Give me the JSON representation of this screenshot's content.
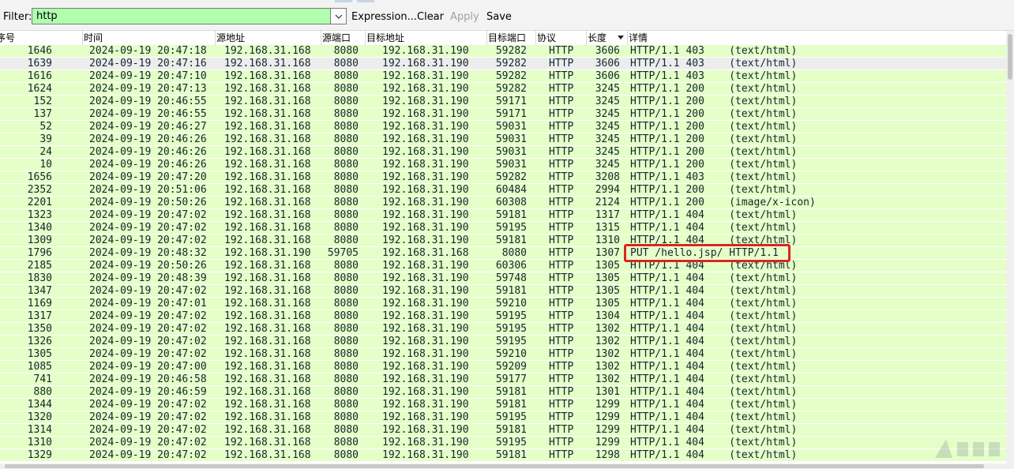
{
  "filter": {
    "label": "Filter:",
    "value": "http",
    "expression_label": "Expression...",
    "clear_label": "Clear",
    "apply_label": "Apply",
    "save_label": "Save"
  },
  "columns": [
    "序号",
    "时间",
    "源地址",
    "源端口",
    "目标地址",
    "目标端口",
    "协议",
    "长度",
    "详情"
  ],
  "selected_row_index": 1,
  "highlighted_row_index": 16,
  "colors": {
    "http_row": "#e4ffc7",
    "selected_row": "#ededed",
    "filter_ok": "#afffaf",
    "highlight_box": "#d9261c"
  },
  "rows": [
    {
      "no": "1646",
      "time": "2024-09-19 20:47:18",
      "src": "192.168.31.168",
      "sport": "8080",
      "dst": "192.168.31.190",
      "dport": "59282",
      "proto": "HTTP",
      "len": "3606",
      "info": "HTTP/1.1 403    (text/html)"
    },
    {
      "no": "1639",
      "time": "2024-09-19 20:47:16",
      "src": "192.168.31.168",
      "sport": "8080",
      "dst": "192.168.31.190",
      "dport": "59282",
      "proto": "HTTP",
      "len": "3606",
      "info": "HTTP/1.1 403    (text/html)"
    },
    {
      "no": "1616",
      "time": "2024-09-19 20:47:10",
      "src": "192.168.31.168",
      "sport": "8080",
      "dst": "192.168.31.190",
      "dport": "59282",
      "proto": "HTTP",
      "len": "3606",
      "info": "HTTP/1.1 403    (text/html)"
    },
    {
      "no": "1624",
      "time": "2024-09-19 20:47:13",
      "src": "192.168.31.168",
      "sport": "8080",
      "dst": "192.168.31.190",
      "dport": "59282",
      "proto": "HTTP",
      "len": "3245",
      "info": "HTTP/1.1 200    (text/html)"
    },
    {
      "no": "152",
      "time": "2024-09-19 20:46:55",
      "src": "192.168.31.168",
      "sport": "8080",
      "dst": "192.168.31.190",
      "dport": "59171",
      "proto": "HTTP",
      "len": "3245",
      "info": "HTTP/1.1 200    (text/html)"
    },
    {
      "no": "137",
      "time": "2024-09-19 20:46:55",
      "src": "192.168.31.168",
      "sport": "8080",
      "dst": "192.168.31.190",
      "dport": "59171",
      "proto": "HTTP",
      "len": "3245",
      "info": "HTTP/1.1 200    (text/html)"
    },
    {
      "no": "52",
      "time": "2024-09-19 20:46:27",
      "src": "192.168.31.168",
      "sport": "8080",
      "dst": "192.168.31.190",
      "dport": "59031",
      "proto": "HTTP",
      "len": "3245",
      "info": "HTTP/1.1 200    (text/html)"
    },
    {
      "no": "39",
      "time": "2024-09-19 20:46:26",
      "src": "192.168.31.168",
      "sport": "8080",
      "dst": "192.168.31.190",
      "dport": "59031",
      "proto": "HTTP",
      "len": "3245",
      "info": "HTTP/1.1 200    (text/html)"
    },
    {
      "no": "24",
      "time": "2024-09-19 20:46:26",
      "src": "192.168.31.168",
      "sport": "8080",
      "dst": "192.168.31.190",
      "dport": "59031",
      "proto": "HTTP",
      "len": "3245",
      "info": "HTTP/1.1 200    (text/html)"
    },
    {
      "no": "10",
      "time": "2024-09-19 20:46:26",
      "src": "192.168.31.168",
      "sport": "8080",
      "dst": "192.168.31.190",
      "dport": "59031",
      "proto": "HTTP",
      "len": "3245",
      "info": "HTTP/1.1 200    (text/html)"
    },
    {
      "no": "1656",
      "time": "2024-09-19 20:47:20",
      "src": "192.168.31.168",
      "sport": "8080",
      "dst": "192.168.31.190",
      "dport": "59282",
      "proto": "HTTP",
      "len": "3208",
      "info": "HTTP/1.1 403    (text/html)"
    },
    {
      "no": "2352",
      "time": "2024-09-19 20:51:06",
      "src": "192.168.31.168",
      "sport": "8080",
      "dst": "192.168.31.190",
      "dport": "60484",
      "proto": "HTTP",
      "len": "2994",
      "info": "HTTP/1.1 200    (text/html)"
    },
    {
      "no": "2201",
      "time": "2024-09-19 20:50:26",
      "src": "192.168.31.168",
      "sport": "8080",
      "dst": "192.168.31.190",
      "dport": "60308",
      "proto": "HTTP",
      "len": "2124",
      "info": "HTTP/1.1 200    (image/x-icon)"
    },
    {
      "no": "1323",
      "time": "2024-09-19 20:47:02",
      "src": "192.168.31.168",
      "sport": "8080",
      "dst": "192.168.31.190",
      "dport": "59181",
      "proto": "HTTP",
      "len": "1317",
      "info": "HTTP/1.1 404    (text/html)"
    },
    {
      "no": "1340",
      "time": "2024-09-19 20:47:02",
      "src": "192.168.31.168",
      "sport": "8080",
      "dst": "192.168.31.190",
      "dport": "59195",
      "proto": "HTTP",
      "len": "1315",
      "info": "HTTP/1.1 404    (text/html)"
    },
    {
      "no": "1309",
      "time": "2024-09-19 20:47:02",
      "src": "192.168.31.168",
      "sport": "8080",
      "dst": "192.168.31.190",
      "dport": "59181",
      "proto": "HTTP",
      "len": "1310",
      "info": "HTTP/1.1 404    (text/html)"
    },
    {
      "no": "1796",
      "time": "2024-09-19 20:48:32",
      "src": "192.168.31.190",
      "sport": "59705",
      "dst": "192.168.31.168",
      "dport": "8080",
      "proto": "HTTP",
      "len": "1307",
      "info": "PUT /hello.jsp/ HTTP/1.1"
    },
    {
      "no": "2185",
      "time": "2024-09-19 20:50:26",
      "src": "192.168.31.168",
      "sport": "8080",
      "dst": "192.168.31.190",
      "dport": "60306",
      "proto": "HTTP",
      "len": "1305",
      "info": "HTTP/1.1 404    (text/html)"
    },
    {
      "no": "1830",
      "time": "2024-09-19 20:48:39",
      "src": "192.168.31.168",
      "sport": "8080",
      "dst": "192.168.31.190",
      "dport": "59748",
      "proto": "HTTP",
      "len": "1305",
      "info": "HTTP/1.1 404    (text/html)"
    },
    {
      "no": "1347",
      "time": "2024-09-19 20:47:02",
      "src": "192.168.31.168",
      "sport": "8080",
      "dst": "192.168.31.190",
      "dport": "59181",
      "proto": "HTTP",
      "len": "1305",
      "info": "HTTP/1.1 404    (text/html)"
    },
    {
      "no": "1169",
      "time": "2024-09-19 20:47:01",
      "src": "192.168.31.168",
      "sport": "8080",
      "dst": "192.168.31.190",
      "dport": "59210",
      "proto": "HTTP",
      "len": "1305",
      "info": "HTTP/1.1 404    (text/html)"
    },
    {
      "no": "1317",
      "time": "2024-09-19 20:47:02",
      "src": "192.168.31.168",
      "sport": "8080",
      "dst": "192.168.31.190",
      "dport": "59195",
      "proto": "HTTP",
      "len": "1304",
      "info": "HTTP/1.1 404    (text/html)"
    },
    {
      "no": "1350",
      "time": "2024-09-19 20:47:02",
      "src": "192.168.31.168",
      "sport": "8080",
      "dst": "192.168.31.190",
      "dport": "59195",
      "proto": "HTTP",
      "len": "1302",
      "info": "HTTP/1.1 404    (text/html)"
    },
    {
      "no": "1326",
      "time": "2024-09-19 20:47:02",
      "src": "192.168.31.168",
      "sport": "8080",
      "dst": "192.168.31.190",
      "dport": "59195",
      "proto": "HTTP",
      "len": "1302",
      "info": "HTTP/1.1 404    (text/html)"
    },
    {
      "no": "1305",
      "time": "2024-09-19 20:47:02",
      "src": "192.168.31.168",
      "sport": "8080",
      "dst": "192.168.31.190",
      "dport": "59210",
      "proto": "HTTP",
      "len": "1302",
      "info": "HTTP/1.1 404    (text/html)"
    },
    {
      "no": "1085",
      "time": "2024-09-19 20:47:00",
      "src": "192.168.31.168",
      "sport": "8080",
      "dst": "192.168.31.190",
      "dport": "59209",
      "proto": "HTTP",
      "len": "1302",
      "info": "HTTP/1.1 404    (text/html)"
    },
    {
      "no": "741",
      "time": "2024-09-19 20:46:58",
      "src": "192.168.31.168",
      "sport": "8080",
      "dst": "192.168.31.190",
      "dport": "59177",
      "proto": "HTTP",
      "len": "1302",
      "info": "HTTP/1.1 404    (text/html)"
    },
    {
      "no": "880",
      "time": "2024-09-19 20:46:59",
      "src": "192.168.31.168",
      "sport": "8080",
      "dst": "192.168.31.190",
      "dport": "59181",
      "proto": "HTTP",
      "len": "1301",
      "info": "HTTP/1.1 404    (text/html)"
    },
    {
      "no": "1344",
      "time": "2024-09-19 20:47:02",
      "src": "192.168.31.168",
      "sport": "8080",
      "dst": "192.168.31.190",
      "dport": "59181",
      "proto": "HTTP",
      "len": "1299",
      "info": "HTTP/1.1 404    (text/html)"
    },
    {
      "no": "1320",
      "time": "2024-09-19 20:47:02",
      "src": "192.168.31.168",
      "sport": "8080",
      "dst": "192.168.31.190",
      "dport": "59195",
      "proto": "HTTP",
      "len": "1299",
      "info": "HTTP/1.1 404    (text/html)"
    },
    {
      "no": "1314",
      "time": "2024-09-19 20:47:02",
      "src": "192.168.31.168",
      "sport": "8080",
      "dst": "192.168.31.190",
      "dport": "59181",
      "proto": "HTTP",
      "len": "1299",
      "info": "HTTP/1.1 404    (text/html)"
    },
    {
      "no": "1310",
      "time": "2024-09-19 20:47:02",
      "src": "192.168.31.168",
      "sport": "8080",
      "dst": "192.168.31.190",
      "dport": "59195",
      "proto": "HTTP",
      "len": "1299",
      "info": "HTTP/1.1 404    (text/html)"
    },
    {
      "no": "1329",
      "time": "2024-09-19 20:47:02",
      "src": "192.168.31.168",
      "sport": "8080",
      "dst": "192.168.31.190",
      "dport": "59181",
      "proto": "HTTP",
      "len": "1298",
      "info": "HTTP/1.1 404    (text/html)"
    }
  ]
}
